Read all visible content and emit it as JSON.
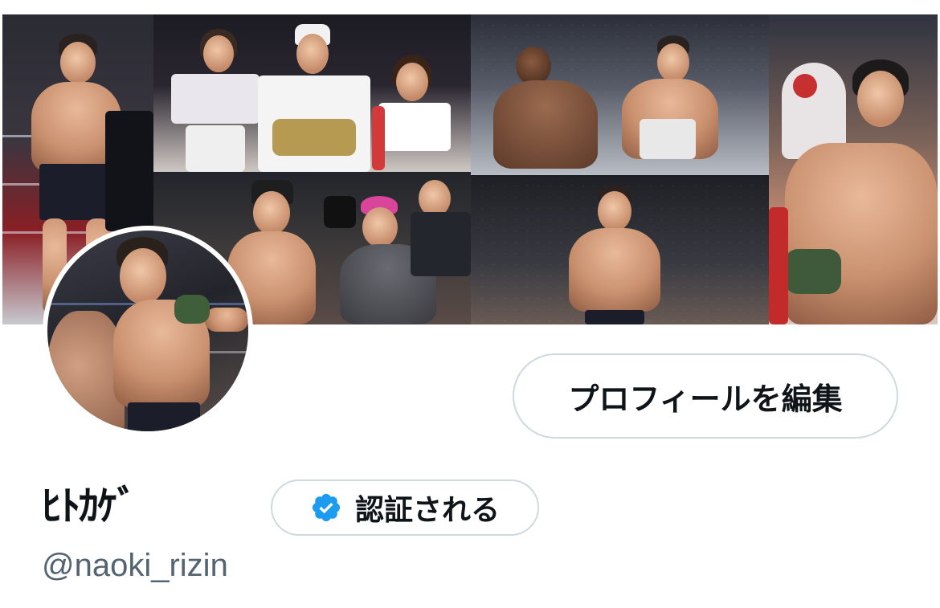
{
  "profile": {
    "display_name": "ﾋﾄｶｹﾞ",
    "handle": "@naoki_rizin",
    "edit_profile_label": "プロフィールを編集",
    "verify_label": "認証される"
  },
  "colors": {
    "text_primary": "#0f1419",
    "text_secondary": "#536471",
    "border": "#cfd9de",
    "verified_blue": "#1d9bf0"
  },
  "icons": {
    "verified_badge": "verified-badge-icon"
  }
}
